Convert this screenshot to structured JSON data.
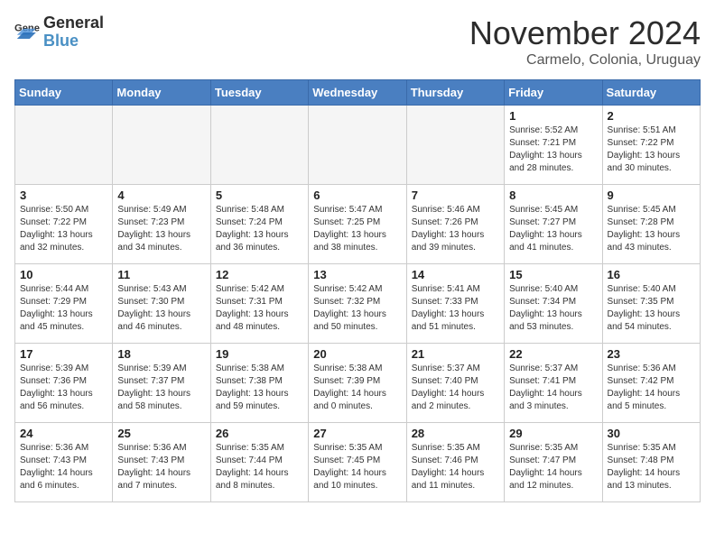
{
  "header": {
    "logo_general": "General",
    "logo_blue": "Blue",
    "month_title": "November 2024",
    "location": "Carmelo, Colonia, Uruguay"
  },
  "weekdays": [
    "Sunday",
    "Monday",
    "Tuesday",
    "Wednesday",
    "Thursday",
    "Friday",
    "Saturday"
  ],
  "weeks": [
    [
      {
        "day": "",
        "sunrise": "",
        "sunset": "",
        "daylight": "",
        "empty": true
      },
      {
        "day": "",
        "sunrise": "",
        "sunset": "",
        "daylight": "",
        "empty": true
      },
      {
        "day": "",
        "sunrise": "",
        "sunset": "",
        "daylight": "",
        "empty": true
      },
      {
        "day": "",
        "sunrise": "",
        "sunset": "",
        "daylight": "",
        "empty": true
      },
      {
        "day": "",
        "sunrise": "",
        "sunset": "",
        "daylight": "",
        "empty": true
      },
      {
        "day": "1",
        "sunrise": "Sunrise: 5:52 AM",
        "sunset": "Sunset: 7:21 PM",
        "daylight": "Daylight: 13 hours and 28 minutes.",
        "empty": false
      },
      {
        "day": "2",
        "sunrise": "Sunrise: 5:51 AM",
        "sunset": "Sunset: 7:22 PM",
        "daylight": "Daylight: 13 hours and 30 minutes.",
        "empty": false
      }
    ],
    [
      {
        "day": "3",
        "sunrise": "Sunrise: 5:50 AM",
        "sunset": "Sunset: 7:22 PM",
        "daylight": "Daylight: 13 hours and 32 minutes.",
        "empty": false
      },
      {
        "day": "4",
        "sunrise": "Sunrise: 5:49 AM",
        "sunset": "Sunset: 7:23 PM",
        "daylight": "Daylight: 13 hours and 34 minutes.",
        "empty": false
      },
      {
        "day": "5",
        "sunrise": "Sunrise: 5:48 AM",
        "sunset": "Sunset: 7:24 PM",
        "daylight": "Daylight: 13 hours and 36 minutes.",
        "empty": false
      },
      {
        "day": "6",
        "sunrise": "Sunrise: 5:47 AM",
        "sunset": "Sunset: 7:25 PM",
        "daylight": "Daylight: 13 hours and 38 minutes.",
        "empty": false
      },
      {
        "day": "7",
        "sunrise": "Sunrise: 5:46 AM",
        "sunset": "Sunset: 7:26 PM",
        "daylight": "Daylight: 13 hours and 39 minutes.",
        "empty": false
      },
      {
        "day": "8",
        "sunrise": "Sunrise: 5:45 AM",
        "sunset": "Sunset: 7:27 PM",
        "daylight": "Daylight: 13 hours and 41 minutes.",
        "empty": false
      },
      {
        "day": "9",
        "sunrise": "Sunrise: 5:45 AM",
        "sunset": "Sunset: 7:28 PM",
        "daylight": "Daylight: 13 hours and 43 minutes.",
        "empty": false
      }
    ],
    [
      {
        "day": "10",
        "sunrise": "Sunrise: 5:44 AM",
        "sunset": "Sunset: 7:29 PM",
        "daylight": "Daylight: 13 hours and 45 minutes.",
        "empty": false
      },
      {
        "day": "11",
        "sunrise": "Sunrise: 5:43 AM",
        "sunset": "Sunset: 7:30 PM",
        "daylight": "Daylight: 13 hours and 46 minutes.",
        "empty": false
      },
      {
        "day": "12",
        "sunrise": "Sunrise: 5:42 AM",
        "sunset": "Sunset: 7:31 PM",
        "daylight": "Daylight: 13 hours and 48 minutes.",
        "empty": false
      },
      {
        "day": "13",
        "sunrise": "Sunrise: 5:42 AM",
        "sunset": "Sunset: 7:32 PM",
        "daylight": "Daylight: 13 hours and 50 minutes.",
        "empty": false
      },
      {
        "day": "14",
        "sunrise": "Sunrise: 5:41 AM",
        "sunset": "Sunset: 7:33 PM",
        "daylight": "Daylight: 13 hours and 51 minutes.",
        "empty": false
      },
      {
        "day": "15",
        "sunrise": "Sunrise: 5:40 AM",
        "sunset": "Sunset: 7:34 PM",
        "daylight": "Daylight: 13 hours and 53 minutes.",
        "empty": false
      },
      {
        "day": "16",
        "sunrise": "Sunrise: 5:40 AM",
        "sunset": "Sunset: 7:35 PM",
        "daylight": "Daylight: 13 hours and 54 minutes.",
        "empty": false
      }
    ],
    [
      {
        "day": "17",
        "sunrise": "Sunrise: 5:39 AM",
        "sunset": "Sunset: 7:36 PM",
        "daylight": "Daylight: 13 hours and 56 minutes.",
        "empty": false
      },
      {
        "day": "18",
        "sunrise": "Sunrise: 5:39 AM",
        "sunset": "Sunset: 7:37 PM",
        "daylight": "Daylight: 13 hours and 58 minutes.",
        "empty": false
      },
      {
        "day": "19",
        "sunrise": "Sunrise: 5:38 AM",
        "sunset": "Sunset: 7:38 PM",
        "daylight": "Daylight: 13 hours and 59 minutes.",
        "empty": false
      },
      {
        "day": "20",
        "sunrise": "Sunrise: 5:38 AM",
        "sunset": "Sunset: 7:39 PM",
        "daylight": "Daylight: 14 hours and 0 minutes.",
        "empty": false
      },
      {
        "day": "21",
        "sunrise": "Sunrise: 5:37 AM",
        "sunset": "Sunset: 7:40 PM",
        "daylight": "Daylight: 14 hours and 2 minutes.",
        "empty": false
      },
      {
        "day": "22",
        "sunrise": "Sunrise: 5:37 AM",
        "sunset": "Sunset: 7:41 PM",
        "daylight": "Daylight: 14 hours and 3 minutes.",
        "empty": false
      },
      {
        "day": "23",
        "sunrise": "Sunrise: 5:36 AM",
        "sunset": "Sunset: 7:42 PM",
        "daylight": "Daylight: 14 hours and 5 minutes.",
        "empty": false
      }
    ],
    [
      {
        "day": "24",
        "sunrise": "Sunrise: 5:36 AM",
        "sunset": "Sunset: 7:43 PM",
        "daylight": "Daylight: 14 hours and 6 minutes.",
        "empty": false
      },
      {
        "day": "25",
        "sunrise": "Sunrise: 5:36 AM",
        "sunset": "Sunset: 7:43 PM",
        "daylight": "Daylight: 14 hours and 7 minutes.",
        "empty": false
      },
      {
        "day": "26",
        "sunrise": "Sunrise: 5:35 AM",
        "sunset": "Sunset: 7:44 PM",
        "daylight": "Daylight: 14 hours and 8 minutes.",
        "empty": false
      },
      {
        "day": "27",
        "sunrise": "Sunrise: 5:35 AM",
        "sunset": "Sunset: 7:45 PM",
        "daylight": "Daylight: 14 hours and 10 minutes.",
        "empty": false
      },
      {
        "day": "28",
        "sunrise": "Sunrise: 5:35 AM",
        "sunset": "Sunset: 7:46 PM",
        "daylight": "Daylight: 14 hours and 11 minutes.",
        "empty": false
      },
      {
        "day": "29",
        "sunrise": "Sunrise: 5:35 AM",
        "sunset": "Sunset: 7:47 PM",
        "daylight": "Daylight: 14 hours and 12 minutes.",
        "empty": false
      },
      {
        "day": "30",
        "sunrise": "Sunrise: 5:35 AM",
        "sunset": "Sunset: 7:48 PM",
        "daylight": "Daylight: 14 hours and 13 minutes.",
        "empty": false
      }
    ]
  ]
}
